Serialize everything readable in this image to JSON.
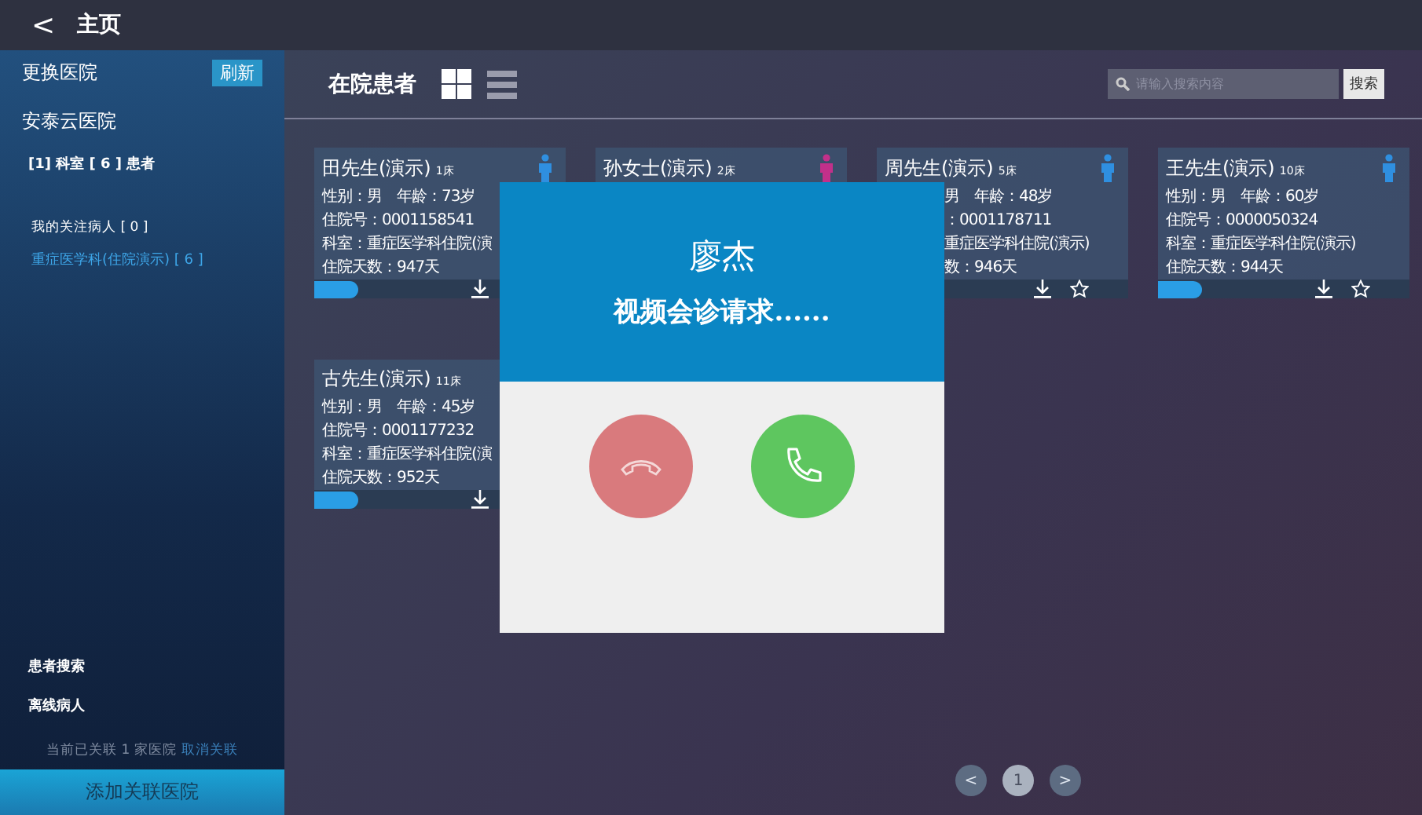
{
  "top_bar": {
    "back": "<",
    "title": "主页"
  },
  "sidebar": {
    "change_hospital": "更换医院",
    "refresh": "刷新",
    "hospital": "安泰云医院",
    "summary": "[1] 科室 [ 6 ] 患者",
    "follow": "我的关注病人 [ 0 ]",
    "departments": [
      {
        "label": "重症医学科(住院演示) [ 6 ]",
        "selected": true
      }
    ],
    "bottom_items": [
      "患者搜索",
      "离线病人"
    ],
    "linked": "当前已关联 1 家医院",
    "unlink": "取消关联",
    "add_button": "添加关联医院"
  },
  "main": {
    "title": "在院患者",
    "view_grid": {
      "selected": true
    },
    "view_list": {
      "selected": false
    },
    "search": {
      "placeholder": "请输入搜索内容",
      "button": "搜索"
    }
  },
  "cards": [
    {
      "name": "田先生(演示)",
      "bed": "1床",
      "color": "#2f8fe0",
      "lines": [
        "性别：男　年龄：73岁",
        "住院号：0001158541",
        "科室：重症医学科住院(演",
        "住院天数：947天"
      ],
      "badge": true,
      "download": true,
      "star": false
    },
    {
      "name": "孙女士(演示)",
      "bed": "2床",
      "color": "#c2308a",
      "badge": false,
      "download": false,
      "star": false
    },
    {
      "name": "周先生(演示)",
      "bed": "5床",
      "color": "#2f8fe0",
      "lines": [
        "男　年龄：48岁",
        "：0001178711",
        "重症医学科住院(演示)",
        "数：946天"
      ],
      "badge": false,
      "download": true,
      "star": true
    },
    {
      "name": "王先生(演示)",
      "bed": "10床",
      "color": "#2f8fe0",
      "lines": [
        "性别：男　年龄：60岁",
        "住院号：0000050324",
        "科室：重症医学科住院(演示)",
        "住院天数：944天"
      ],
      "badge": true,
      "download": true,
      "star": true
    },
    {
      "name": "古先生(演示)",
      "bed": "11床",
      "lines": [
        "性别：男　年龄：45岁",
        "住院号：0001177232",
        "科室：重症医学科住院(演",
        "住院天数：952天"
      ],
      "badge": true,
      "download": true,
      "star": false
    }
  ],
  "pagination": {
    "prev": "<",
    "pages": [
      {
        "label": "1",
        "selected": true
      }
    ],
    "next": ">"
  },
  "call_dialog": {
    "caller": "廖杰",
    "message": "视频会诊请求......"
  }
}
